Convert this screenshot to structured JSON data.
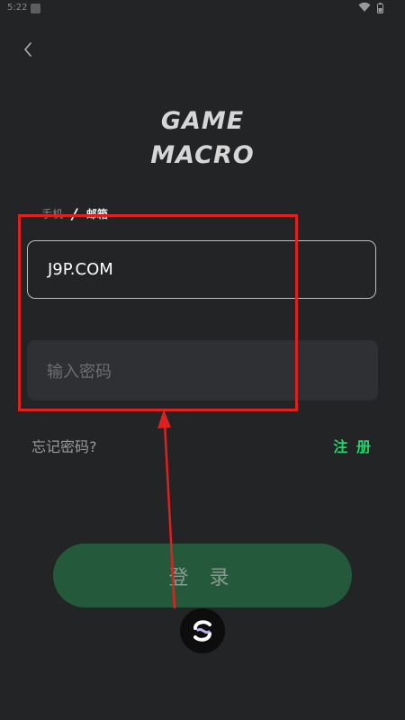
{
  "status_bar": {
    "time": "5:22"
  },
  "logo": {
    "line1": "GAME",
    "line2": "MACRO"
  },
  "tabs": {
    "phone": "手机",
    "separator": "/",
    "email": "邮箱"
  },
  "email_field": {
    "value": "J9P.COM"
  },
  "password_field": {
    "placeholder": "输入密码"
  },
  "links": {
    "forgot_password": "忘记密码?",
    "register": "注 册"
  },
  "login_button": {
    "label": "登 录"
  },
  "colors": {
    "background": "#232426",
    "accent_green": "#26d36a",
    "login_button": "#245a3b",
    "annotation_red": "#e02020"
  },
  "icons": {
    "back": "back-chevron-icon",
    "wifi": "wifi-icon",
    "battery": "battery-icon",
    "widget": "floating-widget-icon"
  }
}
